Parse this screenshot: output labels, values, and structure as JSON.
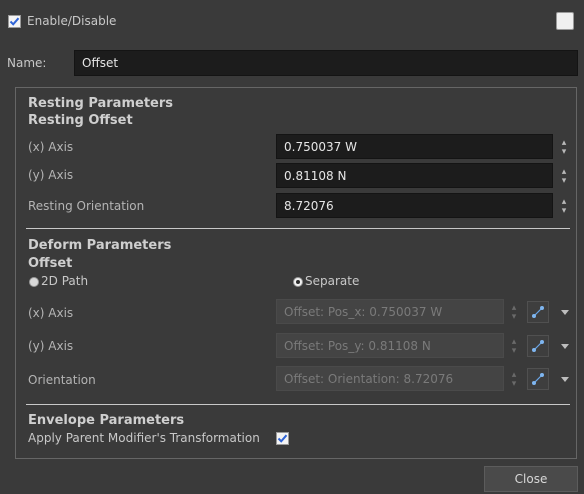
{
  "header": {
    "enable_label": "Enable/Disable"
  },
  "name_row": {
    "label": "Name:",
    "value": "Offset"
  },
  "resting": {
    "title": "Resting Parameters",
    "subtitle": "Resting Offset",
    "x_label": "(x) Axis",
    "x_value": "0.750037 W",
    "y_label": "(y) Axis",
    "y_value": "0.81108 N",
    "orient_label": "Resting Orientation",
    "orient_value": "8.72076"
  },
  "deform": {
    "title": "Deform Parameters",
    "subtitle": "Offset",
    "radio_2d": "2D Path",
    "radio_separate": "Separate",
    "x_label": "(x) Axis",
    "x_value": "Offset: Pos_x: 0.750037 W",
    "y_label": "(y) Axis",
    "y_value": "Offset: Pos_y: 0.81108 N",
    "orient_label": "Orientation",
    "orient_value": "Offset: Orientation: 8.72076"
  },
  "envelope": {
    "title": "Envelope Parameters",
    "apply_label": "Apply Parent Modifier's Transformation"
  },
  "footer": {
    "close_label": "Close"
  },
  "colors": {
    "accent_blue": "#2f64d6",
    "field_bg": "#1c1c1c",
    "bg": "#3a3a3a"
  }
}
